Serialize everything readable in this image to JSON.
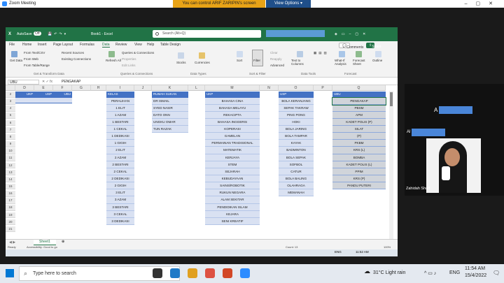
{
  "zoom": {
    "title": "Zoom Meeting",
    "control_banner": "You can control ARIF ZARIPIN's screen",
    "view_options": "View Options"
  },
  "excel": {
    "autosave_label": "AutoSave",
    "autosave_state": "Off",
    "book_title": "Book1 - Excel",
    "search_placeholder": "Search (Alt+Q)",
    "menu": [
      "File",
      "Home",
      "Insert",
      "Page Layout",
      "Formulas",
      "Data",
      "Review",
      "View",
      "Help",
      "Table Design"
    ],
    "active_menu": "Data",
    "comments_label": "Comments",
    "share_label": "Share",
    "ribbon": {
      "get_data": "Get Data",
      "from_text_csv": "From Text/CSV",
      "from_web": "From Web",
      "from_table_range": "From Table/Range",
      "recent_sources": "Recent Sources",
      "existing_connections": "Existing Connections",
      "group_get_transform": "Get & Transform Data",
      "refresh_all": "Refresh All",
      "queries_connections": "Queries & Connections",
      "properties": "Properties",
      "edit_links": "Edit Links",
      "group_queries": "Queries & Connections",
      "stocks": "Stocks",
      "currencies": "Currencies",
      "group_data_types": "Data Types",
      "sort": "Sort",
      "filter": "Filter",
      "clear": "Clear",
      "reapply": "Reapply",
      "advanced": "Advanced",
      "group_sort_filter": "Sort & Filter",
      "text_to_columns": "Text to Columns",
      "group_data_tools": "Data Tools",
      "what_if": "What-If Analysis",
      "forecast_sheet": "Forecast Sheet",
      "group_forecast": "Forecast",
      "outline": "Outline"
    },
    "name_box": "UBU",
    "formula_value": "PENGAKAP",
    "columns": [
      "D",
      "E",
      "F",
      "G",
      "H",
      "I",
      "J",
      "K",
      "L",
      "M",
      "N",
      "O",
      "P",
      "Q"
    ],
    "rows": [
      "2",
      "3",
      "4",
      "5",
      "6",
      "7",
      "8",
      "9",
      "10",
      "11",
      "12",
      "13",
      "14",
      "15",
      "16",
      "17",
      "18",
      "19",
      "20",
      "21"
    ],
    "table_small_headers": [
      "UKP",
      "USP",
      "UBU"
    ],
    "kelas": {
      "header": "KELAS",
      "items": [
        "PERALIHAN",
        "1 ELIT",
        "1 AZAM",
        "1 BESTARI",
        "1 CEKAL",
        "1 DEDIKASI",
        "1 GIGIH",
        "2 ELIT",
        "2 AZAM",
        "2 BESTARI",
        "2 CEKAL",
        "2 DEDIKASI",
        "2 GIGIH",
        "3 ELIT",
        "3 AZAM",
        "3 BESTARI",
        "3 CEKAL",
        "3 DEDIKASI"
      ]
    },
    "rumah_sukan": {
      "header": "RUMAH SUKAN",
      "items": [
        "DR ISMAIL",
        "SYED NASIR",
        "DATO ONN",
        "UNGKU OMAR",
        "TUN RAZAK"
      ]
    },
    "ukp": {
      "header": "UKP",
      "items": [
        "BAHASA CINA",
        "BAHASA MELAYU",
        "REKACIPTA",
        "BAHASA INGGERIS",
        "KOPERASI",
        "GAMELAN",
        "PERMAINAN TRADISIONAL",
        "MATEMATIK",
        "KERJAYA",
        "STEM",
        "SEJARAH",
        "KEBUDAYAAN",
        "SAINS/ROBOTIK",
        "RUKUN NEGARA",
        "ALAM SEKITAR",
        "PENDIDIKAN ISLAM",
        "KEJARA",
        "SENI KREATIF"
      ]
    },
    "usp": {
      "header": "USP",
      "items": [
        "BOLA KERANJANG",
        "SEPAK TAKRAW",
        "PING PONG",
        "HOKI",
        "BOLA JARING",
        "BOLA TAMPAR",
        "KAYAK",
        "BADMINTON",
        "BOLA SEPAK",
        "SOFBOL",
        "CATUR",
        "BOLA BALING",
        "OLAHRAGA",
        "MEMANAH"
      ]
    },
    "ubu": {
      "header": "UBU",
      "items": [
        "PENGAKAP",
        "PBSM",
        "APM",
        "KADET POLIS (P)",
        "SILAT",
        "(P)",
        "PKBM",
        "KRS (L)",
        "BOMBA",
        "KADET POLIS (L)",
        "PPIM",
        "KRS (P)",
        "PANDU PUTERI"
      ]
    },
    "sheet_tab": "Sheet1",
    "status_ready": "Ready",
    "status_accessibility": "Accessibility: Good to go",
    "status_count": "Count: 13",
    "zoom_level": "100%"
  },
  "participant": {
    "name": "Zahidah Shaff",
    "label_a": "A",
    "label_a2": "Al"
  },
  "taskbar": {
    "search_placeholder": "Type here to search",
    "weather": "31°C  Light rain",
    "lang": "ENG",
    "time": "11:54 AM",
    "date": "15/4/2022",
    "inner_time": "11:52 AM",
    "inner_date": "15/4/2022"
  },
  "colors": {
    "excel_green": "#217346",
    "table_blue": "#4472c4",
    "zoom_banner": "#e8a317"
  }
}
